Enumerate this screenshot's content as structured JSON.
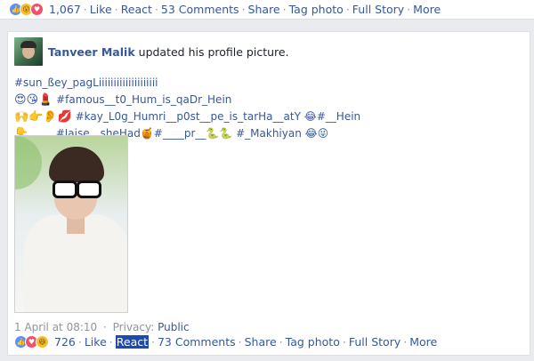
{
  "top_bar": {
    "reactions": [
      "like-icon",
      "wow-icon",
      "love-icon"
    ],
    "count": "1,067",
    "links": [
      "Like",
      "React",
      "53 Comments",
      "Share",
      "Tag photo",
      "Full Story",
      "More"
    ]
  },
  "post": {
    "author": "Tanveer Malik",
    "action": "updated his profile picture.",
    "lines": [
      {
        "emoji": "",
        "text": "#sun_ßey_pagLiiiiiiiiiiiiiiiiiiii"
      },
      {
        "emoji": "😍😘💄",
        "text": "#famous__t0_Hum_is_qaDr_Hein"
      },
      {
        "emoji": "🙌👉👂💋",
        "text": "#kay_L0g_Humri__p0st__pe_is_tarHa__atY 😂#__Hein"
      },
      {
        "emoji": "👇",
        "text": "...... #Jaise__sheHad🍯#____pr__🐍🐍 #_Makhiyan 😂😜"
      }
    ],
    "timestamp": "1 April at 08:10",
    "privacy_label": "Privacy:",
    "privacy_value": "Public",
    "reactions": [
      "like-icon",
      "love-icon",
      "haha-icon"
    ],
    "count": "726",
    "links": [
      "Like",
      "React",
      "73 Comments",
      "Share",
      "Tag photo",
      "Full Story",
      "More"
    ]
  }
}
